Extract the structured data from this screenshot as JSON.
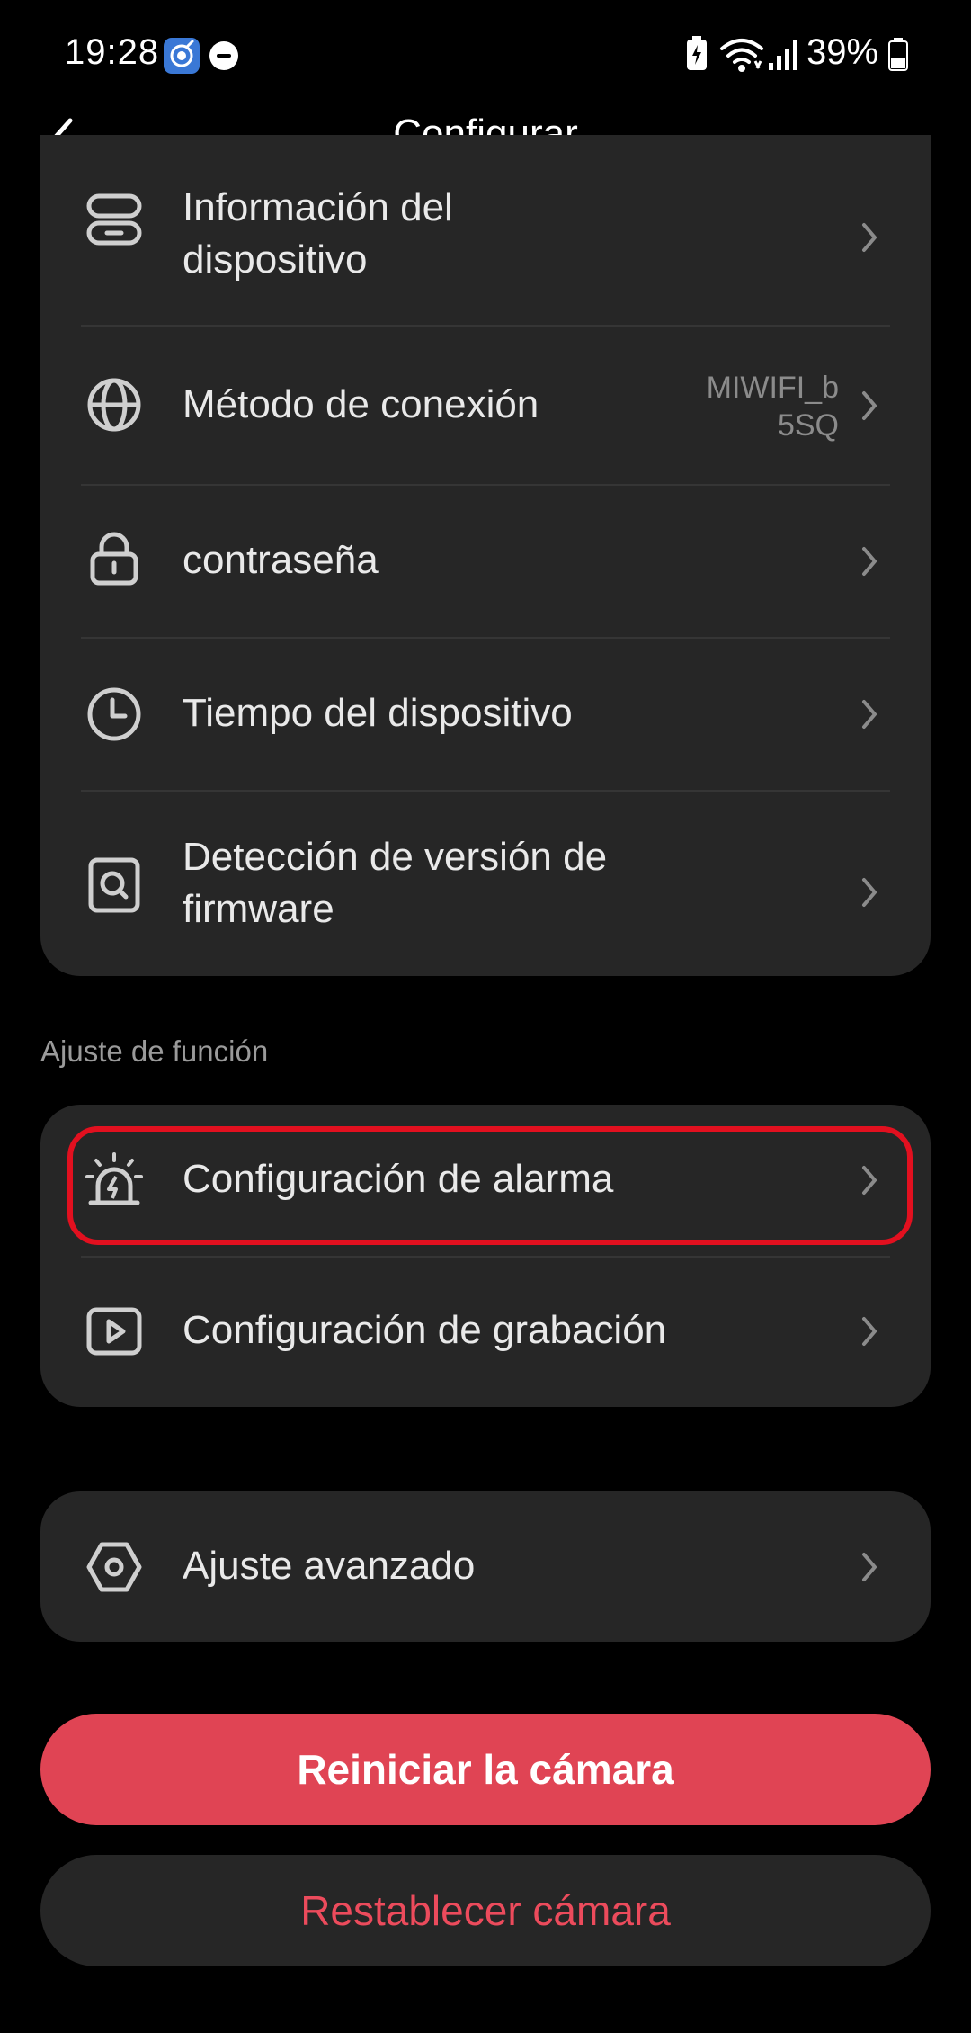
{
  "status_bar": {
    "time": "19:28",
    "battery_percent": "39%",
    "icons": [
      "app-notification-icon",
      "do-not-disturb-icon",
      "battery-saver-icon",
      "wifi-icon",
      "signal-icon",
      "battery-icon"
    ]
  },
  "header": {
    "title": "Configurar",
    "back_icon": "chevron-left-icon"
  },
  "device_settings": {
    "items": [
      {
        "label_line1": "Información del",
        "label_line2": "dispositivo",
        "icon": "device-info-icon"
      },
      {
        "label": "Método de conexión",
        "value_line1": "MIWIFI_b",
        "value_line2": "5SQ",
        "icon": "globe-icon"
      },
      {
        "label": "contraseña",
        "icon": "lock-icon"
      },
      {
        "label": "Tiempo del dispositivo",
        "icon": "clock-icon"
      },
      {
        "label_line1": "Detección de versión de",
        "label_line2": "firmware",
        "icon": "firmware-search-icon"
      }
    ]
  },
  "function_settings": {
    "section_title": "Ajuste de función",
    "items": [
      {
        "label": "Configuración de alarma",
        "icon": "alarm-siren-icon",
        "highlighted": true,
        "highlight_color": "#e2101f"
      },
      {
        "label": "Configuración de grabación",
        "icon": "video-play-icon"
      }
    ]
  },
  "advanced": {
    "label": "Ajuste avanzado",
    "icon": "hexagon-settings-icon"
  },
  "buttons": {
    "reboot": "Reiniciar la cámara",
    "reset": "Restablecer cámara"
  },
  "colors": {
    "background": "#000000",
    "card": "#262626",
    "accent_red": "#e04454",
    "reset_text": "#ec4b5c"
  }
}
